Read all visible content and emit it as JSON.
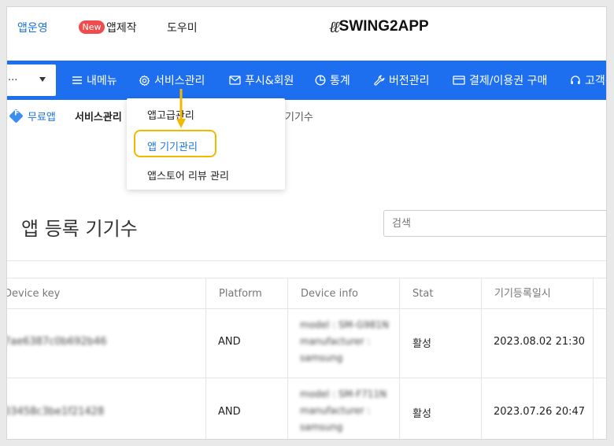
{
  "topbar": {
    "app_ops": "앱운영",
    "new_badge": "New",
    "app_make": "앱제작",
    "help": "도우미",
    "logo_text": "SWING2APP"
  },
  "nav": {
    "app_select_value": "...",
    "items": [
      {
        "label": "내메뉴",
        "icon": "hamburger-icon"
      },
      {
        "label": "서비스관리",
        "icon": "gear-icon"
      },
      {
        "label": "푸시&회원",
        "icon": "mail-icon"
      },
      {
        "label": "통계",
        "icon": "pie-chart-icon"
      },
      {
        "label": "버전관리",
        "icon": "wrench-icon"
      },
      {
        "label": "결제/이용권 구매",
        "icon": "credit-card-icon"
      },
      {
        "label": "고객센",
        "icon": "headset-icon"
      }
    ],
    "bar_color": "#1d6ff0"
  },
  "breadcrumb": {
    "free_badge": "F",
    "free": "무료앱",
    "service": "서비스관리",
    "current": "기기수"
  },
  "dropdown": {
    "items": [
      "앱고급관리",
      "앱 기기관리",
      "앱스토어 리뷰 관리"
    ],
    "selected_index": 1,
    "highlight_color": "#f5b800"
  },
  "page": {
    "title": "앱 등록 기기수",
    "search_placeholder": "검색"
  },
  "table": {
    "headers": [
      "Device key",
      "Platform",
      "Device info",
      "Stat",
      "기기등록일시"
    ],
    "rows": [
      {
        "device_key": "7ae6387c0b692b46",
        "platform": "AND",
        "info": [
          "model : SM-G981N",
          "manufacturer :",
          "samsung"
        ],
        "stat": "활성",
        "registered": "2023.08.02 21:30"
      },
      {
        "device_key": "03458c3be1f21428",
        "platform": "AND",
        "info": [
          "model : SM-F711N",
          "manufacturer :",
          "samsung"
        ],
        "stat": "활성",
        "registered": "2023.07.26 20:47"
      }
    ]
  }
}
